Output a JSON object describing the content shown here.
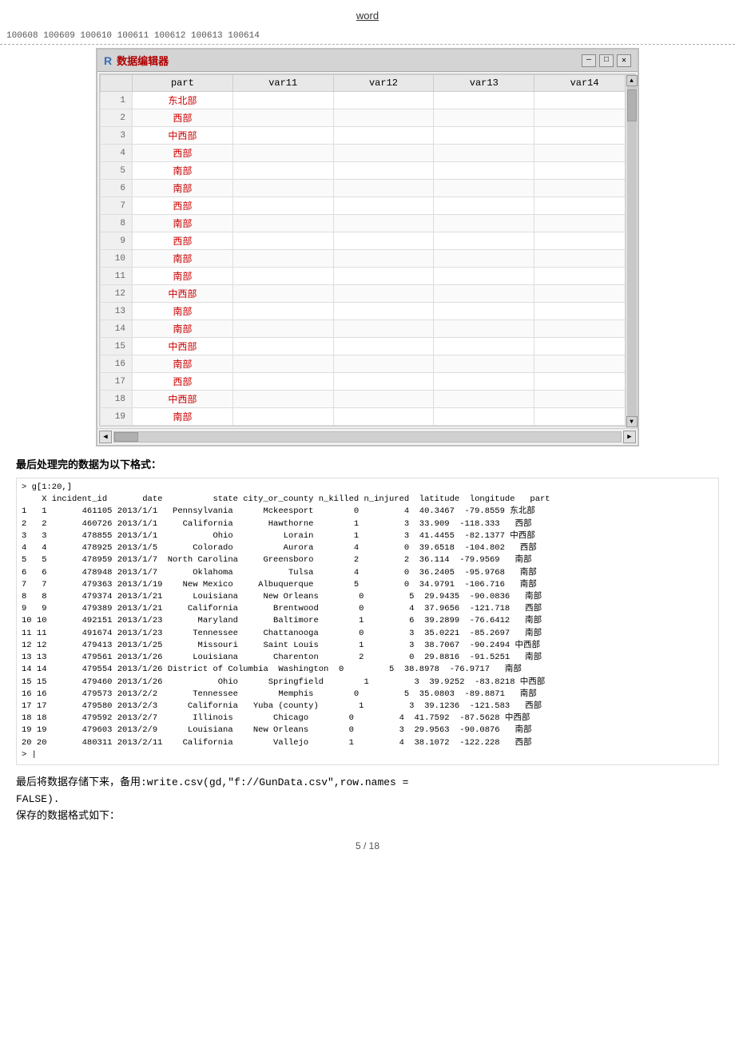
{
  "top": {
    "word_link": "word"
  },
  "scroll_header": {
    "text": "100608  100609  100610  100611  100612  100613  100614"
  },
  "editor_window": {
    "title": "数据编辑器",
    "r_logo": "R",
    "columns": [
      "part",
      "var11",
      "var12",
      "var13",
      "var14"
    ],
    "rows": [
      {
        "num": 1,
        "part": "东北部",
        "var11": "",
        "var12": "",
        "var13": "",
        "var14": ""
      },
      {
        "num": 2,
        "part": "西部",
        "var11": "",
        "var12": "",
        "var13": "",
        "var14": ""
      },
      {
        "num": 3,
        "part": "中西部",
        "var11": "",
        "var12": "",
        "var13": "",
        "var14": ""
      },
      {
        "num": 4,
        "part": "西部",
        "var11": "",
        "var12": "",
        "var13": "",
        "var14": ""
      },
      {
        "num": 5,
        "part": "南部",
        "var11": "",
        "var12": "",
        "var13": "",
        "var14": ""
      },
      {
        "num": 6,
        "part": "南部",
        "var11": "",
        "var12": "",
        "var13": "",
        "var14": ""
      },
      {
        "num": 7,
        "part": "西部",
        "var11": "",
        "var12": "",
        "var13": "",
        "var14": ""
      },
      {
        "num": 8,
        "part": "南部",
        "var11": "",
        "var12": "",
        "var13": "",
        "var14": ""
      },
      {
        "num": 9,
        "part": "西部",
        "var11": "",
        "var12": "",
        "var13": "",
        "var14": ""
      },
      {
        "num": 10,
        "part": "南部",
        "var11": "",
        "var12": "",
        "var13": "",
        "var14": ""
      },
      {
        "num": 11,
        "part": "南部",
        "var11": "",
        "var12": "",
        "var13": "",
        "var14": ""
      },
      {
        "num": 12,
        "part": "中西部",
        "var11": "",
        "var12": "",
        "var13": "",
        "var14": ""
      },
      {
        "num": 13,
        "part": "南部",
        "var11": "",
        "var12": "",
        "var13": "",
        "var14": ""
      },
      {
        "num": 14,
        "part": "南部",
        "var11": "",
        "var12": "",
        "var13": "",
        "var14": ""
      },
      {
        "num": 15,
        "part": "中西部",
        "var11": "",
        "var12": "",
        "var13": "",
        "var14": ""
      },
      {
        "num": 16,
        "part": "南部",
        "var11": "",
        "var12": "",
        "var13": "",
        "var14": ""
      },
      {
        "num": 17,
        "part": "西部",
        "var11": "",
        "var12": "",
        "var13": "",
        "var14": ""
      },
      {
        "num": 18,
        "part": "中西部",
        "var11": "",
        "var12": "",
        "var13": "",
        "var14": ""
      },
      {
        "num": 19,
        "part": "南部",
        "var11": "",
        "var12": "",
        "var13": "",
        "var14": ""
      }
    ]
  },
  "section1_title": "最后处理完的数据为以下格式：",
  "console_output": {
    "lines": [
      "> g[1:20,]",
      "    X incident_id       date          state city_or_county n_killed n_injured  latitude  longitude   part",
      "1   1       461105 2013/1/1   Pennsylvania      Mckeesport        0         4  40.3467  -79.8559 东北部",
      "2   2       460726 2013/1/1     California       Hawthorne        1         3  33.909  -118.333   西部",
      "3   3       478855 2013/1/1           Ohio          Lorain        1         3  41.4455  -82.1377 中西部",
      "4   4       478925 2013/1/5       Colorado          Aurora        4         0  39.6518  -104.802   西部",
      "5   5       478959 2013/1/7  North Carolina     Greensboro        2         2  36.114  -79.9569   南部",
      "6   6       478948 2013/1/7       Oklahoma           Tulsa        4         0  36.2405  -95.9768   南部",
      "7   7       479363 2013/1/19    New Mexico     Albuquerque        5         0  34.9791  -106.716   南部",
      "8   8       479374 2013/1/21      Louisiana     New Orleans        0         5  29.9435  -90.0836   南部",
      "9   9       479389 2013/1/21     California       Brentwood        0         4  37.9656  -121.718   西部",
      "10 10       492151 2013/1/23       Maryland       Baltimore        1         6  39.2899  -76.6412   南部",
      "11 11       491674 2013/1/23      Tennessee     Chattanooga        0         3  35.0221  -85.2697   南部",
      "12 12       479413 2013/1/25       Missouri     Saint Louis        1         3  38.7067  -90.2494 中西部",
      "13 13       479561 2013/1/26      Louisiana       Charenton        2         0  29.8816  -91.5251   南部",
      "14 14       479554 2013/1/26 District of Columbia  Washington  0         5  38.8978  -76.9717   南部",
      "15 15       479460 2013/1/26           Ohio      Springfield        1         3  39.9252  -83.8218 中西部",
      "16 16       479573 2013/2/2       Tennessee        Memphis        0         5  35.0803  -89.8871   南部",
      "17 17       479580 2013/2/3      California   Yuba (county)        1         3  39.1236  -121.583   西部",
      "18 18       479592 2013/2/7       Illinois        Chicago        0         4  41.7592  -87.5628 中西部",
      "19 19       479603 2013/2/9      Louisiana    New Orleans        0         3  29.9563  -90.0876   南部",
      "20 20       480311 2013/2/11    California        Vallejo        1         4  38.1072  -122.228   西部",
      "> |"
    ]
  },
  "bottom_text1": "最后将数据存储下来，备用:write.csv(gd,\"f://GunData.csv\",row.names =",
  "bottom_text2": "FALSE).",
  "bottom_text3": "保存的数据格式如下：",
  "page_number": "5 / 18"
}
